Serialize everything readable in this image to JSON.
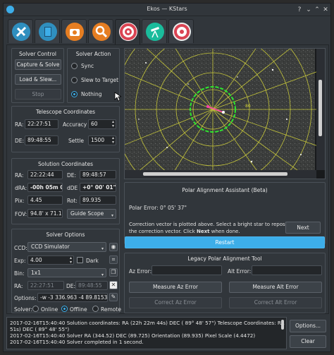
{
  "window": {
    "title": "Ekos — KStars"
  },
  "tabs": [
    {
      "name": "setup",
      "color": "#3daee9"
    },
    {
      "name": "scheduler",
      "color": "#3daee9"
    },
    {
      "name": "capture",
      "color": "#e67e22"
    },
    {
      "name": "focus",
      "color": "#e67e22"
    },
    {
      "name": "align",
      "color": "#da4453"
    },
    {
      "name": "mount",
      "color": "#1abc9c"
    },
    {
      "name": "guide",
      "color": "#da4453"
    }
  ],
  "solver_control": {
    "title": "Solver Control",
    "capture_solve": "Capture & Solve",
    "load_slew": "Load & Slew...",
    "stop": "Stop"
  },
  "solver_action": {
    "title": "Solver Action",
    "sync": "Sync",
    "slew_to_target": "Slew to Target",
    "nothing": "Nothing",
    "selected": "nothing"
  },
  "telescope": {
    "title": "Telescope Coordinates",
    "ra_label": "RA:",
    "ra": "22:27:51",
    "de_label": "DE:",
    "de": "89:48:55",
    "accuracy_label": "Accuracy",
    "accuracy": "60",
    "settle_label": "Settle",
    "settle": "1500"
  },
  "solution": {
    "title": "Solution Coordinates",
    "ra_label": "RA:",
    "ra": "22:22:44",
    "de_label": "DE:",
    "de": "89:48:57",
    "dra_label": "dRA:",
    "dra": "-00h 05m 07s",
    "dde_label": "dDE",
    "dde": "+0° 00' 01\"",
    "pix_label": "Pix:",
    "pix": "4.45",
    "rot_label": "Rot:",
    "rot": "89.935",
    "fov_label": "FOV:",
    "fov": "94.8' x 71.1'",
    "scope": "Guide Scope"
  },
  "solver_options": {
    "title": "Solver Options",
    "ccd_label": "CCD:",
    "ccd": "CCD Simulator",
    "exp_label": "Exp:",
    "exp": "4.00",
    "dark_label": "Dark",
    "bin_label": "Bin:",
    "bin": "1x1",
    "ra_label": "RA:",
    "ra": "22:27:51",
    "de_label": "DE:",
    "de": "89:48:55",
    "options_label": "Options:",
    "options": "-w -3 336.963 -4 89.8153 -5 30",
    "solver_label": "Solver:",
    "online": "Online",
    "offline": "Offline",
    "remote": "Remote",
    "selected": "offline"
  },
  "polar": {
    "title": "Polar Alignment Assistant (Beta)",
    "error": "Polar Error:  0° 05' 37\"",
    "instruction_1": "Correction vector is plotted above. Select a bright star to reposition",
    "instruction_2_pre": "the correction vector. Click ",
    "instruction_2_bold": "Next",
    "instruction_2_post": " when done.",
    "next": "Next",
    "restart": "Restart"
  },
  "legacy": {
    "title": "Legacy Polar Alignment Tool",
    "az_error_label": "Az Error:",
    "alt_error_label": "Alt Error:",
    "measure_az": "Measure Az Error",
    "measure_alt": "Measure Alt Error",
    "correct_az": "Correct Az Error",
    "correct_alt": "Correct Alt Error"
  },
  "log": [
    "2017-02-16T15:40:40 Solution coordinates: RA (22h 22m 44s) DEC ( 89° 48' 57\") Telescope Coordinates: RA (22h 27m",
    "51s) DEC ( 89° 48' 55\")",
    "2017-02-16T15:40:40 Solver RA (344.52) DEC (89.725) Orientation (89.935) Pixel Scale (4.4472)",
    "2017-02-16T15:40:40 Solver completed in 1 second."
  ],
  "log_buttons": {
    "options": "Options...",
    "clear": "Clear"
  },
  "sky_label": "80"
}
